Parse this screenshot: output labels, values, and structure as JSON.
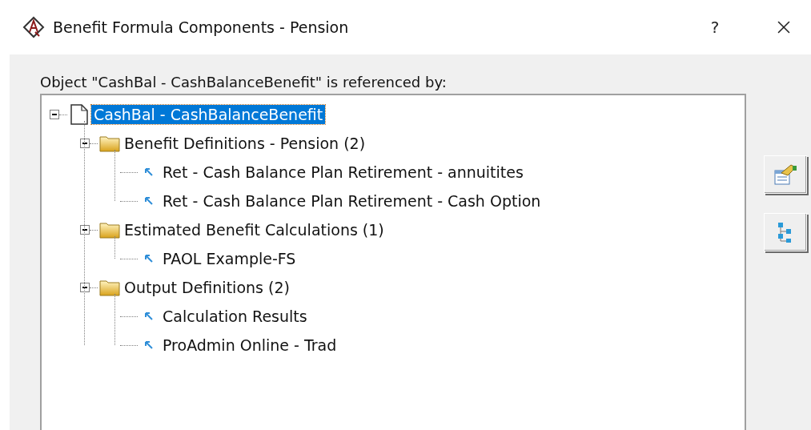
{
  "window": {
    "title": "Benefit Formula Components - Pension",
    "help": "?"
  },
  "caption": "Object \"CashBal - CashBalanceBenefit\" is referenced by:",
  "tree": [
    {
      "kind": "document",
      "label": "CashBal - CashBalanceBenefit",
      "selected": true,
      "expanded": true,
      "children": [
        {
          "kind": "folder",
          "label": "Benefit Definitions - Pension (2)",
          "selected": false,
          "expanded": true,
          "children": [
            {
              "kind": "reference",
              "label": "Ret - Cash Balance Plan Retirement - annuitites",
              "selected": false
            },
            {
              "kind": "reference",
              "label": "Ret - Cash Balance Plan Retirement - Cash Option",
              "selected": false
            }
          ]
        },
        {
          "kind": "folder",
          "label": "Estimated Benefit Calculations (1)",
          "selected": false,
          "expanded": true,
          "children": [
            {
              "kind": "reference",
              "label": "PAOL Example-FS",
              "selected": false
            }
          ]
        },
        {
          "kind": "folder",
          "label": "Output Definitions (2)",
          "selected": false,
          "expanded": true,
          "children": [
            {
              "kind": "reference",
              "label": "Calculation Results",
              "selected": false
            },
            {
              "kind": "reference",
              "label": "ProAdmin Online - Trad",
              "selected": false
            }
          ]
        }
      ]
    }
  ]
}
